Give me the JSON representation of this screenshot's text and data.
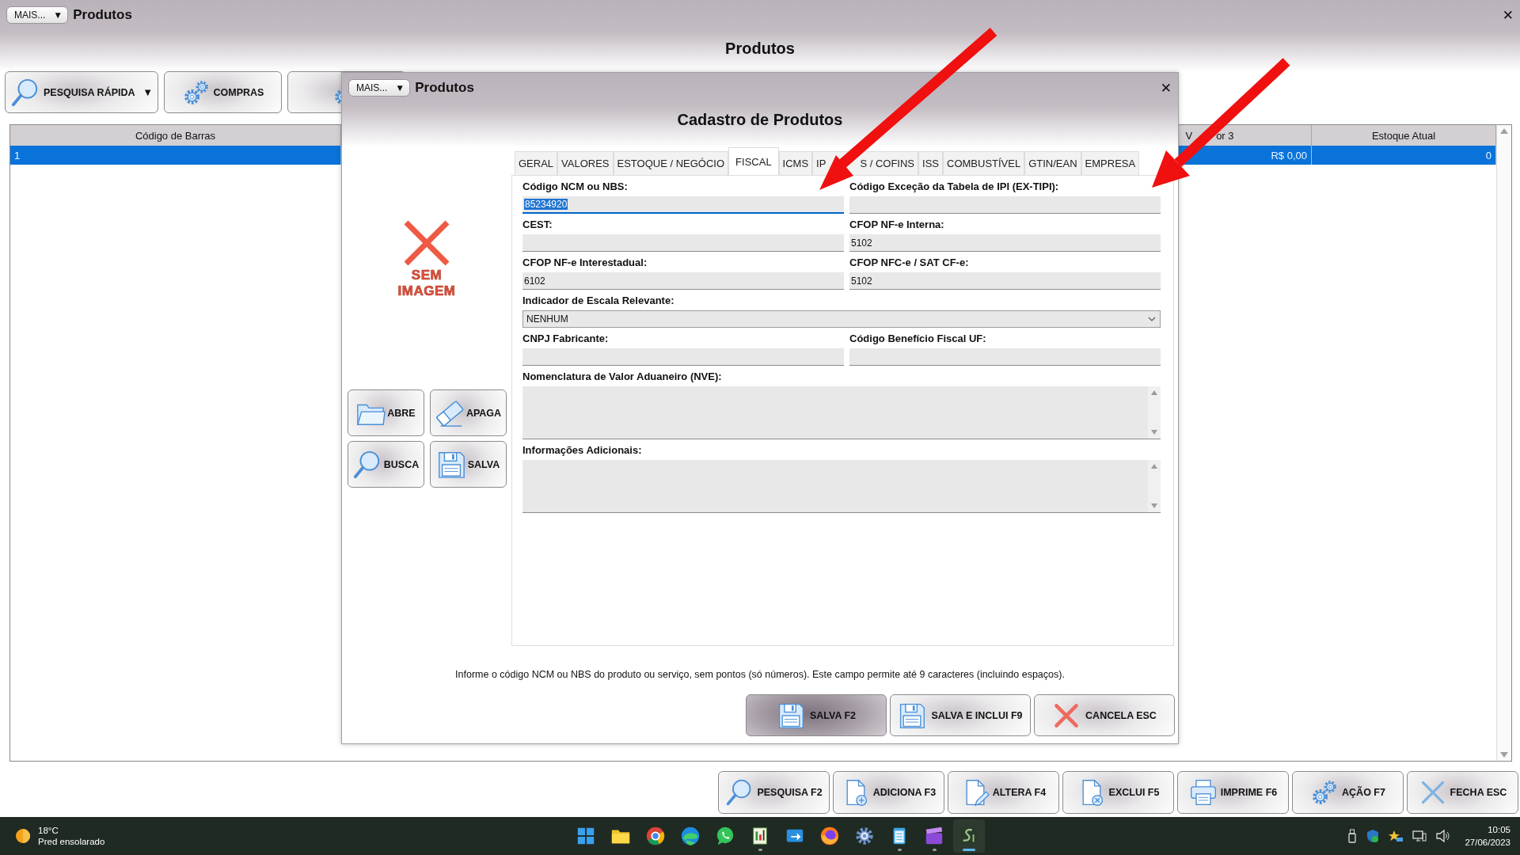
{
  "window": {
    "menu_button": {
      "label": "MAIS...",
      "caret": "▼"
    },
    "title": "Produtos",
    "close": "✕",
    "heading": "Produtos"
  },
  "toolbar": [
    {
      "label": "PESQUISA RÁPIDA",
      "kind": "search",
      "caret": "▼"
    },
    {
      "label": "COMPRAS",
      "kind": "gears"
    },
    {
      "kind": "gears"
    }
  ],
  "table": {
    "columns": [
      {
        "label": "Código de Barras"
      },
      {
        "label_parts": [
          "V",
          "or 3"
        ]
      },
      {
        "label": "Estoque Atual"
      }
    ],
    "rows": [
      {
        "cells": [
          "1",
          "R$ 0,00",
          "0"
        ],
        "selected": true
      }
    ]
  },
  "actions": [
    {
      "label": "PESQUISA F2",
      "kind": "search"
    },
    {
      "label": "ADICIONA F3",
      "kind": "add"
    },
    {
      "label": "ALTERA F4",
      "kind": "edit"
    },
    {
      "label": "EXCLUI F5",
      "kind": "delete"
    },
    {
      "label": "IMPRIME F6",
      "kind": "print"
    },
    {
      "label": "AÇÃO F7",
      "kind": "gears"
    },
    {
      "label": "FECHA ESC",
      "kind": "close"
    }
  ],
  "dialog": {
    "menu_button": {
      "label": "MAIS...",
      "caret": "▼"
    },
    "title": "Produtos",
    "close": "✕",
    "heading": "Cadastro de Produtos",
    "image_placeholder": "SEM IMAGEM",
    "image_buttons": [
      {
        "label": "ABRE",
        "kind": "open"
      },
      {
        "label": "APAGA",
        "kind": "erase"
      },
      {
        "label": "BUSCA",
        "kind": "search"
      },
      {
        "label": "SALVA",
        "kind": "save"
      }
    ],
    "tabs": [
      {
        "label": "GERAL",
        "selected": false
      },
      {
        "label": "VALORES",
        "selected": false
      },
      {
        "label": "ESTOQUE / NEGÓCIO",
        "selected": false
      },
      {
        "label": "FISCAL",
        "selected": true
      },
      {
        "label": "ICMS",
        "selected": false
      },
      {
        "label_parts": [
          "IP",
          "S / COFINS"
        ],
        "selected": false
      },
      {
        "label": "ISS",
        "selected": false
      },
      {
        "label": "COMBUSTÍVEL",
        "selected": false
      },
      {
        "label": "GTIN/EAN",
        "selected": false
      },
      {
        "label": "EMPRESA",
        "selected": false
      }
    ],
    "fields": [
      {
        "label": "Código NCM ou NBS:",
        "kind": "text",
        "value": "85234920",
        "focused": true
      },
      {
        "label": "Código Exceção da Tabela de IPI (EX-TIPI):",
        "kind": "text",
        "focused": false
      },
      {
        "label": "CEST:",
        "kind": "text",
        "focused": false
      },
      {
        "label": "CFOP NF-e Interna:",
        "kind": "text",
        "value": "5102",
        "focused": false
      },
      {
        "label": "CFOP NF-e Interestadual:",
        "kind": "text",
        "value": "6102",
        "focused": false
      },
      {
        "label": "CFOP NFC-e / SAT CF-e:",
        "kind": "text",
        "value": "5102",
        "focused": false
      },
      {
        "label": "Indicador de Escala Relevante:",
        "kind": "select",
        "value": "NENHUM"
      },
      {
        "label": "CNPJ Fabricante:",
        "kind": "text",
        "focused": false
      },
      {
        "label": "Código Benefício Fiscal UF:",
        "kind": "text",
        "focused": false
      },
      {
        "label": "Nomenclatura de Valor Aduaneiro (NVE):",
        "kind": "textarea"
      },
      {
        "label": "Informações Adicionais:",
        "kind": "textarea"
      }
    ],
    "hint": "Informe o código NCM ou NBS do produto ou serviço, sem pontos (só números). Este campo permite até 9 caracteres (incluindo espaços).",
    "buttons": [
      {
        "label": "SALVA F2",
        "kind": "save",
        "highlighted": true
      },
      {
        "label": "SALVA E INCLUI F9",
        "kind": "save",
        "highlighted": false
      },
      {
        "label": "CANCELA ESC",
        "kind": "cancel",
        "highlighted": false
      }
    ]
  },
  "taskbar": {
    "weather": {
      "temperature": "18°C",
      "description": "Pred ensolarado"
    },
    "apps": [
      {
        "kind": "start",
        "selected": false,
        "running": false
      },
      {
        "kind": "explorer",
        "selected": false,
        "running": false
      },
      {
        "kind": "chrome",
        "selected": false,
        "running": false
      },
      {
        "kind": "edge",
        "selected": false,
        "running": false
      },
      {
        "kind": "whatsapp",
        "selected": false,
        "running": false
      },
      {
        "kind": "sheet",
        "selected": false,
        "running": true
      },
      {
        "kind": "remote",
        "selected": false,
        "running": false
      },
      {
        "kind": "firefox",
        "selected": false,
        "running": false
      },
      {
        "kind": "settings",
        "selected": false,
        "running": false
      },
      {
        "kind": "notepad",
        "selected": false,
        "running": true
      },
      {
        "kind": "video",
        "selected": false,
        "running": true
      },
      {
        "kind": "sg",
        "selected": true,
        "running": true
      }
    ],
    "clock": {
      "time": "10:05",
      "date": "27/06/2023"
    }
  }
}
